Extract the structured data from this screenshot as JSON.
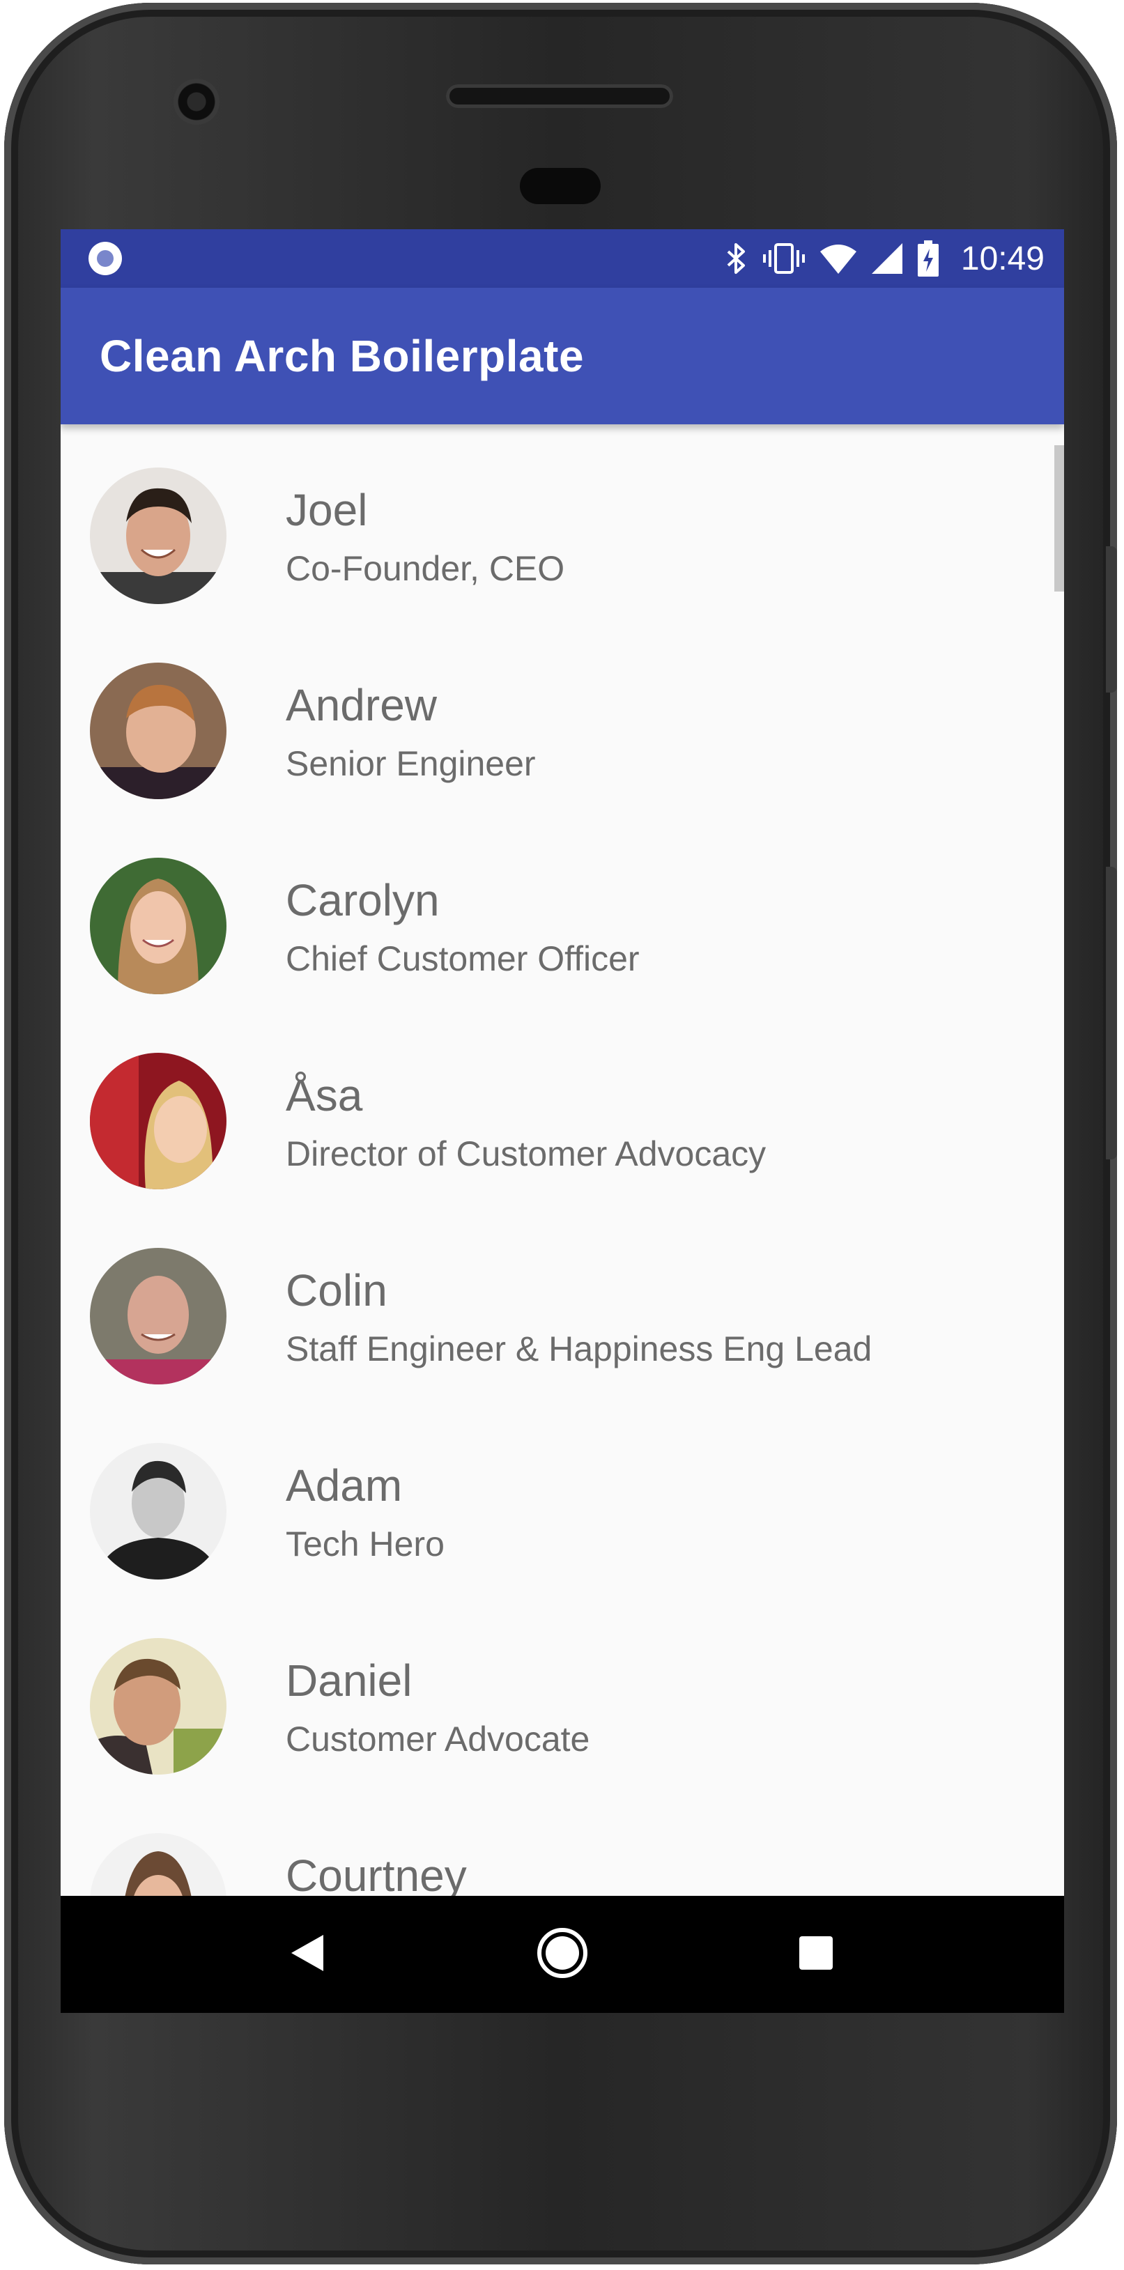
{
  "status_bar": {
    "time": "10:49",
    "icons": [
      "app-notification-icon",
      "bluetooth-icon",
      "vibrate-icon",
      "wifi-icon",
      "cell-signal-icon",
      "battery-charging-icon"
    ]
  },
  "app_bar": {
    "title": "Clean Arch Boilerplate"
  },
  "team": [
    {
      "name": "Joel",
      "title": "Co-Founder, CEO"
    },
    {
      "name": "Andrew",
      "title": "Senior Engineer"
    },
    {
      "name": "Carolyn",
      "title": "Chief Customer Officer"
    },
    {
      "name": "Åsa",
      "title": "Director of Customer Advocacy"
    },
    {
      "name": "Colin",
      "title": "Staff Engineer & Happiness Eng Lead"
    },
    {
      "name": "Adam",
      "title": "Tech Hero"
    },
    {
      "name": "Daniel",
      "title": "Customer Advocate"
    },
    {
      "name": "Courtney",
      "title": ""
    }
  ],
  "nav_bar": {
    "buttons": [
      "back-icon",
      "home-icon",
      "recents-icon"
    ]
  },
  "colors": {
    "status_bar": "#303f9f",
    "app_bar": "#3f51b5",
    "list_background": "#fafafa",
    "text": "#6b6b6b"
  }
}
